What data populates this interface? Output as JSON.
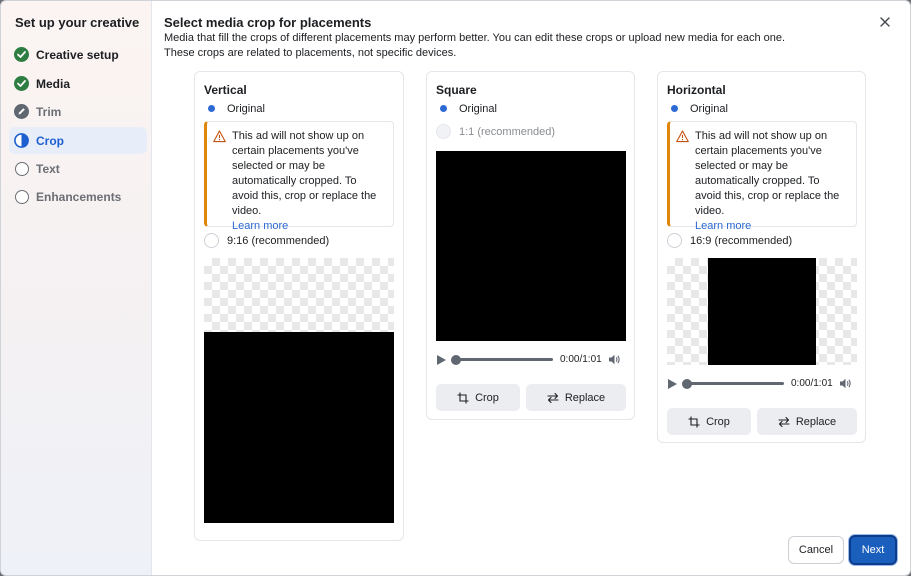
{
  "sidebar": {
    "title": "Set up your creative",
    "steps": [
      {
        "label": "Creative setup",
        "state": "done",
        "icon": "check-circle-icon"
      },
      {
        "label": "Media",
        "state": "done",
        "icon": "check-circle-icon"
      },
      {
        "label": "Trim",
        "state": "pending",
        "icon": "pencil-icon"
      },
      {
        "label": "Crop",
        "state": "active",
        "icon": "half-circle-icon"
      },
      {
        "label": "Text",
        "state": "pending",
        "icon": "empty-circle-icon"
      },
      {
        "label": "Enhancements",
        "state": "pending",
        "icon": "empty-circle-icon"
      }
    ]
  },
  "header": {
    "title": "Select media crop for placements",
    "desc_line1": "Media that fill the crops of different placements may perform better. You can edit these crops or upload new media for each one.",
    "desc_line2": "These crops are related to placements, not specific devices."
  },
  "warning": {
    "text": "This ad will not show up on certain placements you've selected or may be automatically cropped. To avoid this, crop or replace the video.",
    "link": "Learn more"
  },
  "cards": {
    "vertical": {
      "title": "Vertical",
      "original": "Original",
      "recommended": "9:16 (recommended)"
    },
    "square": {
      "title": "Square",
      "original": "Original",
      "recommended": "1:1 (recommended)",
      "time": "0:00/1:01",
      "crop": "Crop",
      "replace": "Replace"
    },
    "horizontal": {
      "title": "Horizontal",
      "original": "Original",
      "recommended": "16:9 (recommended)",
      "time": "0:00/1:01",
      "crop": "Crop",
      "replace": "Replace"
    }
  },
  "footer": {
    "cancel": "Cancel",
    "next": "Next"
  },
  "colors": {
    "accent": "#2d6ad3",
    "success": "#2e7d42",
    "warning": "#e0860a",
    "primary_button": "#1b5fbd"
  }
}
